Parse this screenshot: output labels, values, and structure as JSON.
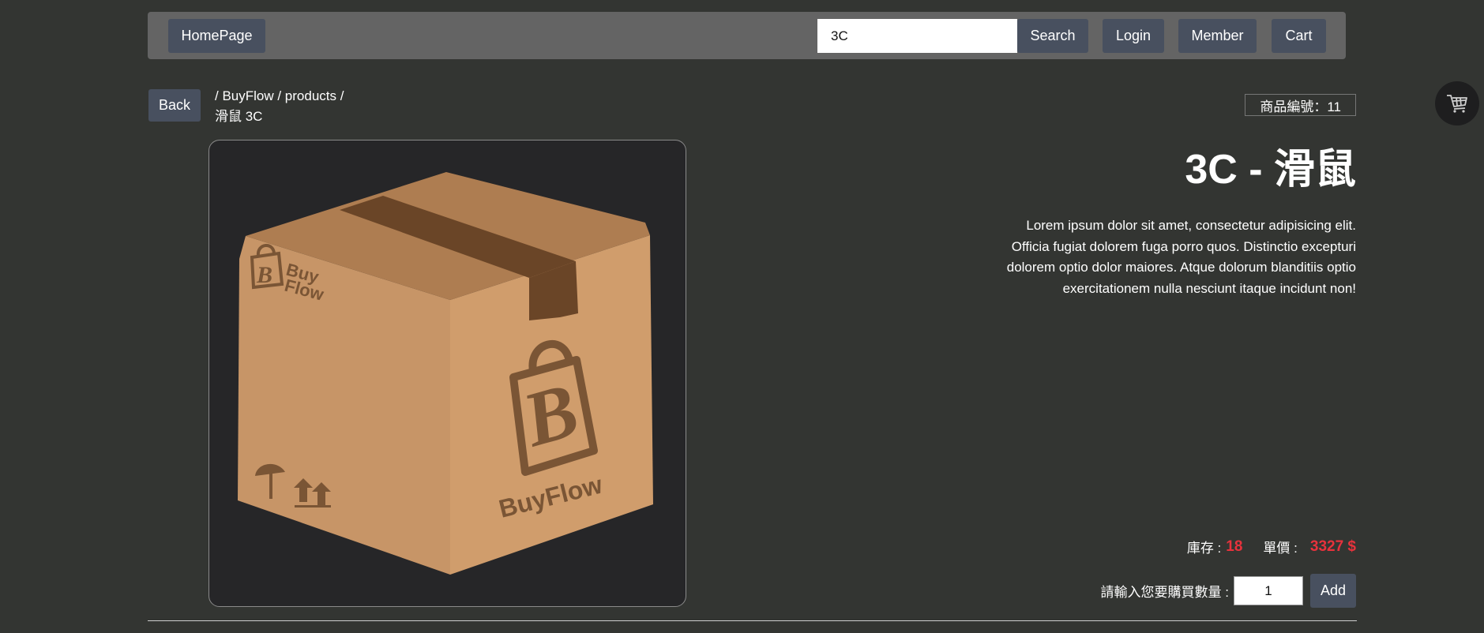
{
  "nav": {
    "home_label": "HomePage",
    "search_value": "3C",
    "search_label": "Search",
    "login_label": "Login",
    "member_label": "Member",
    "cart_label": "Cart"
  },
  "back_label": "Back",
  "breadcrumb": {
    "path": "/ BuyFlow / products /",
    "current": "滑鼠 3C"
  },
  "product": {
    "id_text": "商品編號：11",
    "title": "3C - 滑鼠",
    "description": "Lorem ipsum dolor sit amet, consectetur adipisicing elit. Officia fugiat dolorem fuga porro quos. Distinctio excepturi dolorem optio dolor maiores. Atque dolorum blanditiis optio exercitationem nulla nesciunt itaque incidunt non!",
    "stock_label": "庫存 :",
    "stock_value": "18",
    "price_label": "單價 :",
    "price_value": "3327 $",
    "image_brand": "BuyFlow",
    "image_brand_small_1": "Buy",
    "image_brand_small_2": "Flow"
  },
  "purchase": {
    "qty_label": "請輸入您要購買數量 :",
    "qty_value": "1",
    "add_label": "Add"
  },
  "icons": {
    "floating_cart": "shopping-cart-icon"
  },
  "colors": {
    "background": "#333532",
    "navbar": "#646464",
    "button": "#48505f",
    "accent_red": "#e8323c"
  }
}
